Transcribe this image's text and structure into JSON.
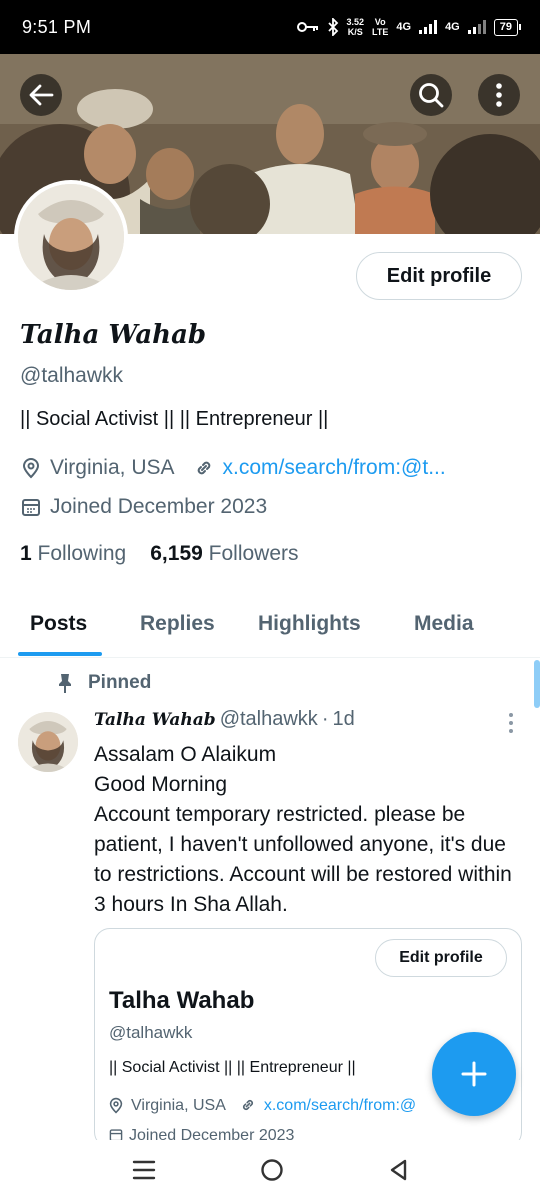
{
  "status": {
    "time": "9:51 PM",
    "speed_value": "3.52",
    "speed_unit": "K/S",
    "volte_top": "Vo",
    "volte_bottom": "LTE",
    "net1": "4G",
    "net2": "4G",
    "battery": "79"
  },
  "profile": {
    "edit_label": "Edit profile",
    "display_name": "Talha Wahab",
    "handle": "@talhawkk",
    "bio": "|| Social Activist || || Entrepreneur ||",
    "location": "Virginia, USA",
    "link": "x.com/search/from:@t...",
    "joined": "Joined December 2023",
    "following_count": "1",
    "following_label": "Following",
    "followers_count": "6,159",
    "followers_label": "Followers"
  },
  "tabs": [
    {
      "label": "Posts"
    },
    {
      "label": "Replies"
    },
    {
      "label": "Highlights"
    },
    {
      "label": "Media"
    }
  ],
  "post": {
    "pinned_label": "Pinned",
    "author_name": "Talha Wahab",
    "author_handle": "@talhawkk",
    "separator": "·",
    "time": "1d",
    "lines": [
      "Assalam O Alaikum",
      "Good Morning",
      "Account temporary restricted. please be patient, I haven't unfollowed anyone, it's due to restrictions. Account will be restored within 3 hours In Sha Allah."
    ]
  },
  "card": {
    "edit_label": "Edit profile",
    "name": "Talha Wahab",
    "handle": "@talhawkk",
    "bio": "|| Social Activist || || Entrepreneur ||",
    "location": "Virginia, USA",
    "link": "x.com/search/from:@",
    "joined": "Joined December 2023"
  },
  "colors": {
    "accent": "#1d9bf0",
    "text": "#0f1419",
    "muted": "#536471"
  },
  "icons": {
    "back": "arrow-left-icon",
    "search": "search-icon",
    "more": "more-vertical-icon",
    "location": "location-pin-icon",
    "link": "link-icon",
    "calendar": "calendar-icon",
    "pin": "pin-icon",
    "compose": "plus-icon"
  }
}
